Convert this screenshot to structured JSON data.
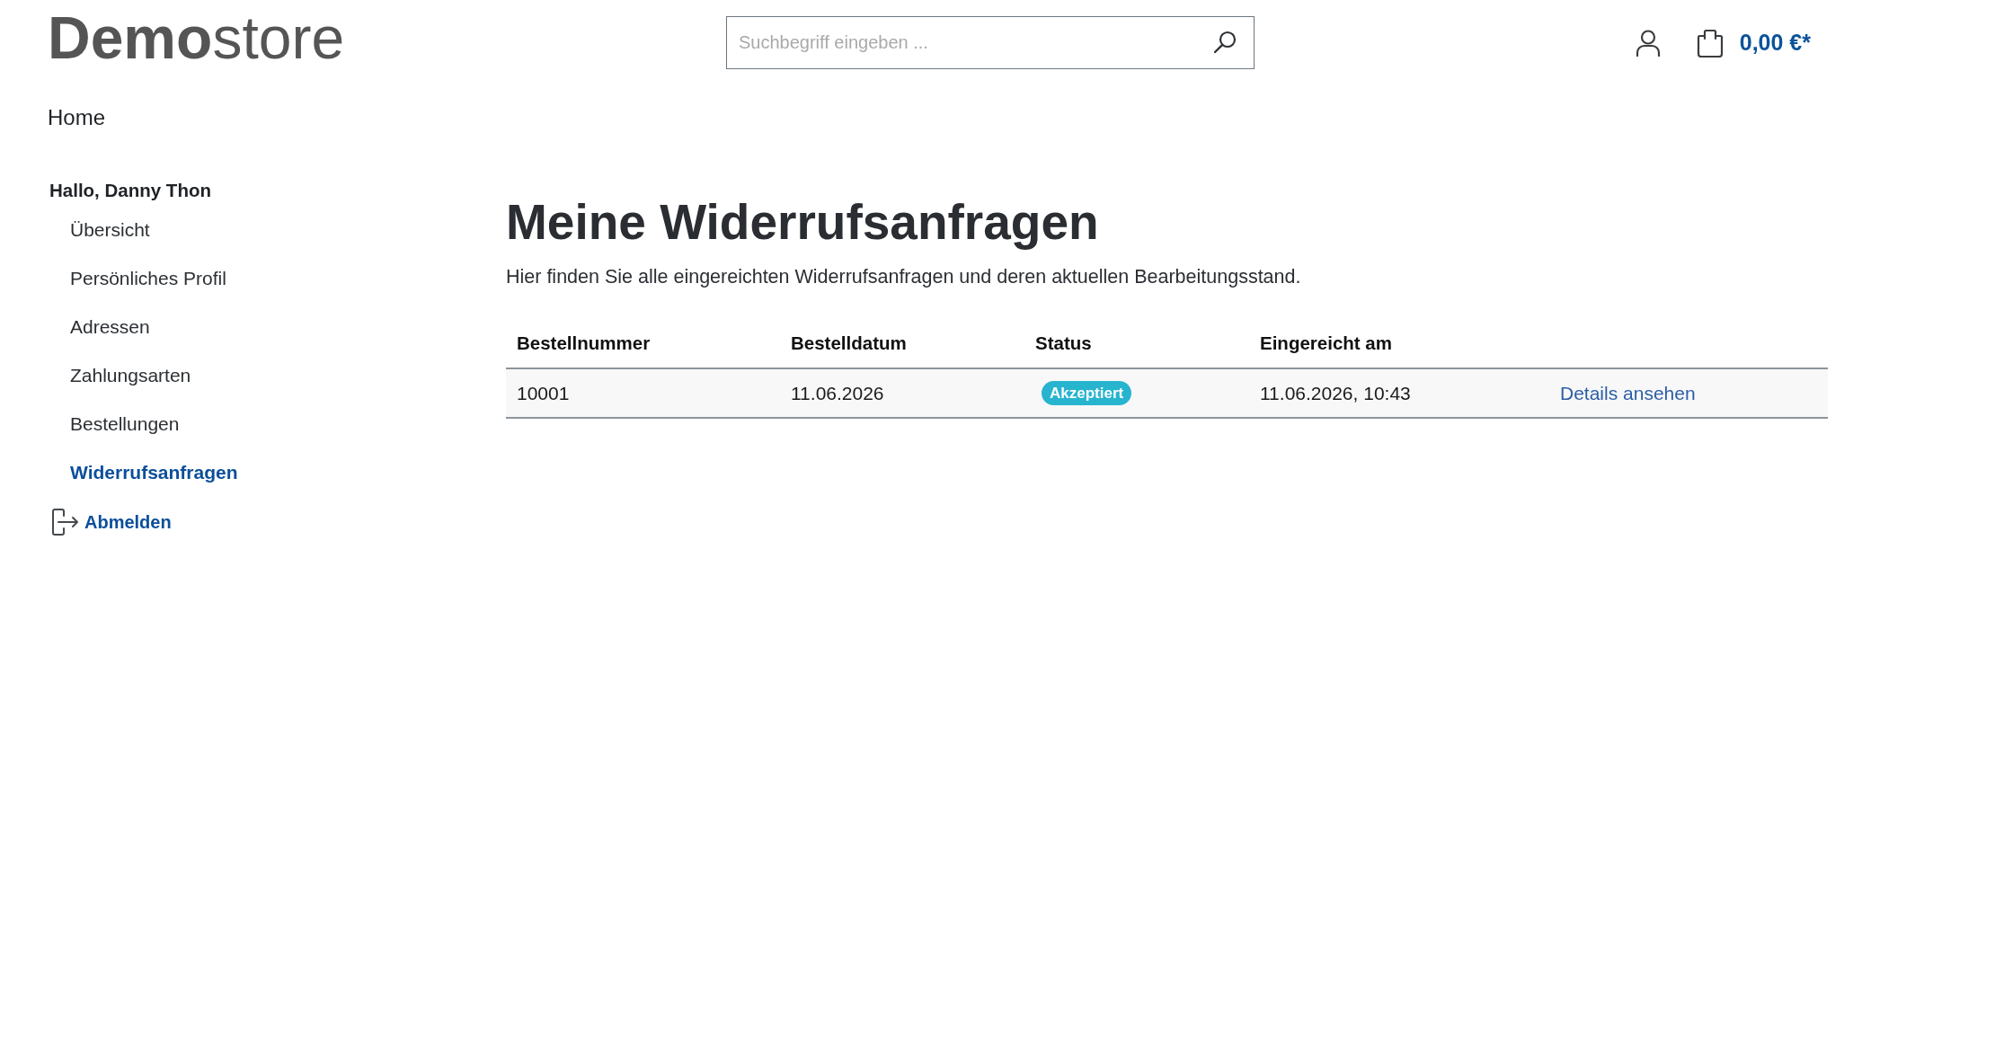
{
  "header": {
    "logo": "**Demo**store",
    "search": {
      "placeholder": "Suchbegriff eingeben ..."
    },
    "cart_total": "0,00 €*"
  },
  "nav": [
    {
      "label": "Home"
    }
  ],
  "sidebar": {
    "greeting": "Hallo, Danny Thon",
    "items": [
      {
        "label": "Übersicht",
        "selected": false
      },
      {
        "label": "Persönliches Profil",
        "selected": false
      },
      {
        "label": "Adressen",
        "selected": false
      },
      {
        "label": "Zahlungsarten",
        "selected": false
      },
      {
        "label": "Bestellungen",
        "selected": false
      },
      {
        "label": "Widerrufsanfragen",
        "selected": true
      }
    ],
    "logout": "Abmelden"
  },
  "main": {
    "title": "Meine Widerrufsanfragen",
    "description": "Hier finden Sie alle eingereichten Widerrufsanfragen und deren aktuellen Bearbeitungsstand.",
    "table": {
      "columns": [
        "Bestellnummer",
        "Bestelldatum",
        "Status",
        "Eingereicht am"
      ],
      "rows": [
        {
          "order_number": "10001",
          "order_date": "11.06.2026",
          "status": {
            "label": "Akzeptiert",
            "color": "#27b4cf"
          },
          "submitted": "11.06.2026, 10:43",
          "action": "Details ansehen"
        }
      ]
    }
  }
}
